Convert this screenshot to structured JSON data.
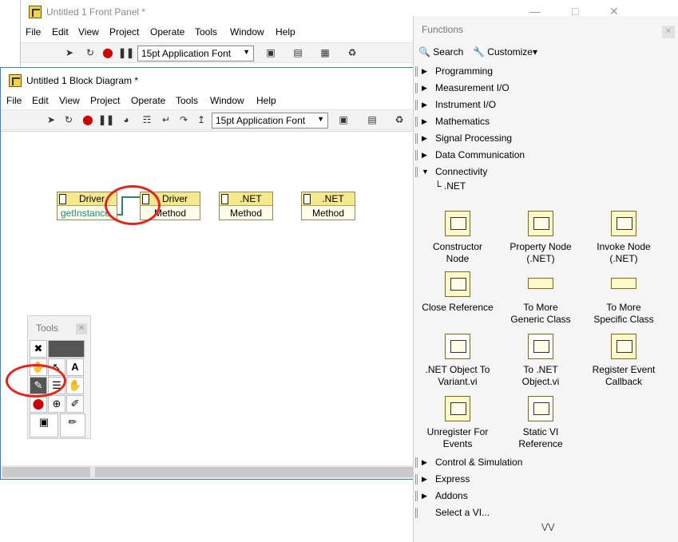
{
  "front_panel": {
    "title": "Untitled 1 Front Panel *",
    "menu": [
      "File",
      "Edit",
      "View",
      "Project",
      "Operate",
      "Tools",
      "Window",
      "Help"
    ],
    "font_select": "15pt Application Font"
  },
  "block_diagram": {
    "title": "Untitled 1 Block Diagram *",
    "menu": [
      "File",
      "Edit",
      "View",
      "Project",
      "Operate",
      "Tools",
      "Window",
      "Help"
    ],
    "font_select": "15pt Application Font",
    "nodes": [
      {
        "header": "Driver",
        "row": "getInstance"
      },
      {
        "header": "Driver",
        "row": "Method"
      },
      {
        "header": ".NET",
        "row": "Method"
      },
      {
        "header": ".NET",
        "row": "Method"
      }
    ]
  },
  "tools_palette": {
    "title": "Tools"
  },
  "functions_palette": {
    "title": "Functions",
    "search_label": "Search",
    "customize_label": "Customize",
    "categories_top": [
      "Programming",
      "Measurement I/O",
      "Instrument I/O",
      "Mathematics",
      "Signal Processing",
      "Data Communication",
      "Connectivity"
    ],
    "sub_category": ".NET",
    "items": [
      {
        "label1": "Constructor",
        "label2": "Node"
      },
      {
        "label1": "Property Node",
        "label2": "(.NET)"
      },
      {
        "label1": "Invoke Node",
        "label2": "(.NET)"
      },
      {
        "label1": "Close Reference",
        "label2": ""
      },
      {
        "label1": "To More",
        "label2": "Generic Class"
      },
      {
        "label1": "To More",
        "label2": "Specific Class"
      },
      {
        "label1": ".NET Object To",
        "label2": "Variant.vi"
      },
      {
        "label1": "To .NET",
        "label2": "Object.vi"
      },
      {
        "label1": "Register Event",
        "label2": "Callback"
      },
      {
        "label1": "Unregister For",
        "label2": "Events"
      },
      {
        "label1": "Static VI",
        "label2": "Reference"
      }
    ],
    "categories_bottom": [
      "Control & Simulation",
      "Express",
      "Addons",
      "Select a VI..."
    ],
    "more_icon": "double-chevron-down-icon"
  },
  "colors": {
    "highlight_ring": "#e0261c",
    "wire": "#2f7f73",
    "node_header": "#f5e88c"
  }
}
